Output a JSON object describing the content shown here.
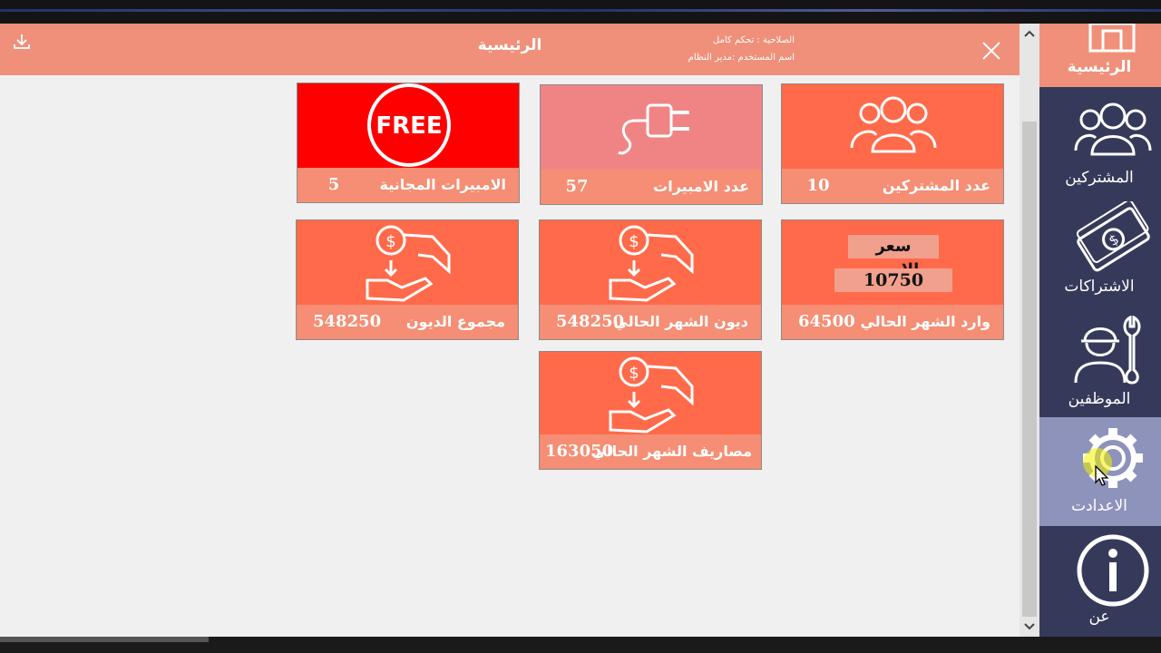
{
  "header": {
    "title": "الرئيسية",
    "permission_line": "الصلاحية : تحكم كامل",
    "user_line": "اسم المستخدم :مدير النظام",
    "download_icon": "download-icon",
    "close_icon": "close-icon"
  },
  "tiles": {
    "subscribers": {
      "label": "عدد المشتركين",
      "value": "10",
      "icon": "users-icon"
    },
    "amperes": {
      "label": "عدد الامبيرات",
      "value": "57",
      "icon": "plug-icon"
    },
    "free_amperes": {
      "label": "الامبيرات المجانية",
      "value": "5",
      "icon": "free-icon",
      "icon_text": "FREE"
    },
    "price": {
      "title": "سعر الامبير",
      "value": "10750"
    },
    "monthly_income": {
      "label": "وارد الشهر الحالي",
      "value": "64500"
    },
    "monthly_debts": {
      "label": "ديون الشهر الحالي",
      "value": "548250",
      "icon": "money-hand-icon"
    },
    "total_debts": {
      "label": "مجموع الديون",
      "value": "548250",
      "icon": "money-hand-icon"
    },
    "monthly_expenses": {
      "label": "مصاريف الشهر الحالي",
      "value": "163050",
      "icon": "money-hand-icon"
    }
  },
  "sidebar": {
    "items": [
      {
        "label": "الرئيسية",
        "icon": "home-icon"
      },
      {
        "label": "المشتركين",
        "icon": "users-icon"
      },
      {
        "label": "الاشتراكات",
        "icon": "banknote-icon"
      },
      {
        "label": "الموظفين",
        "icon": "worker-icon"
      },
      {
        "label": "الاعدادت",
        "icon": "gear-icon"
      },
      {
        "label": "عن",
        "icon": "info-icon"
      }
    ]
  },
  "colors": {
    "header": "#f0907a",
    "tile": "#ff6a4a",
    "tile_label": "#f58e74",
    "tile_red": "#ff0000",
    "tile_pink": "#f08484",
    "sidebar": "#363a5a",
    "sidebar_active": "#8e93bb"
  }
}
